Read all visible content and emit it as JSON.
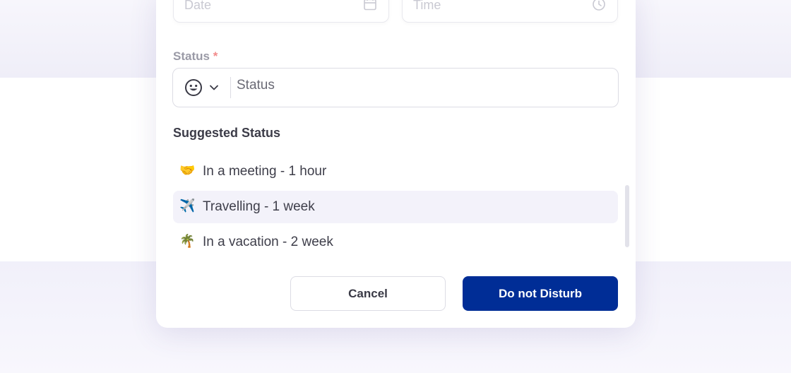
{
  "form": {
    "date": {
      "placeholder": "Date",
      "icon": "calendar-icon"
    },
    "time": {
      "placeholder": "Time",
      "icon": "clock-icon"
    },
    "status_label": "Status",
    "status_required_mark": "*",
    "status_input": {
      "placeholder": "Status",
      "value": ""
    },
    "emoji_picker_icon": "smiley-icon"
  },
  "suggested": {
    "heading": "Suggested Status",
    "items": [
      {
        "emoji": "🤝",
        "label": "In a meeting - 1 hour",
        "active": false
      },
      {
        "emoji": "✈️",
        "label": "Travelling - 1 week",
        "active": true
      },
      {
        "emoji": "🌴",
        "label": "In a vacation - 2 week",
        "active": false
      }
    ]
  },
  "actions": {
    "cancel_label": "Cancel",
    "primary_label": "Do not Disturb"
  },
  "colors": {
    "primary": "#002d96",
    "required": "#f28b8b",
    "hover_row": "#f3f2fa"
  }
}
